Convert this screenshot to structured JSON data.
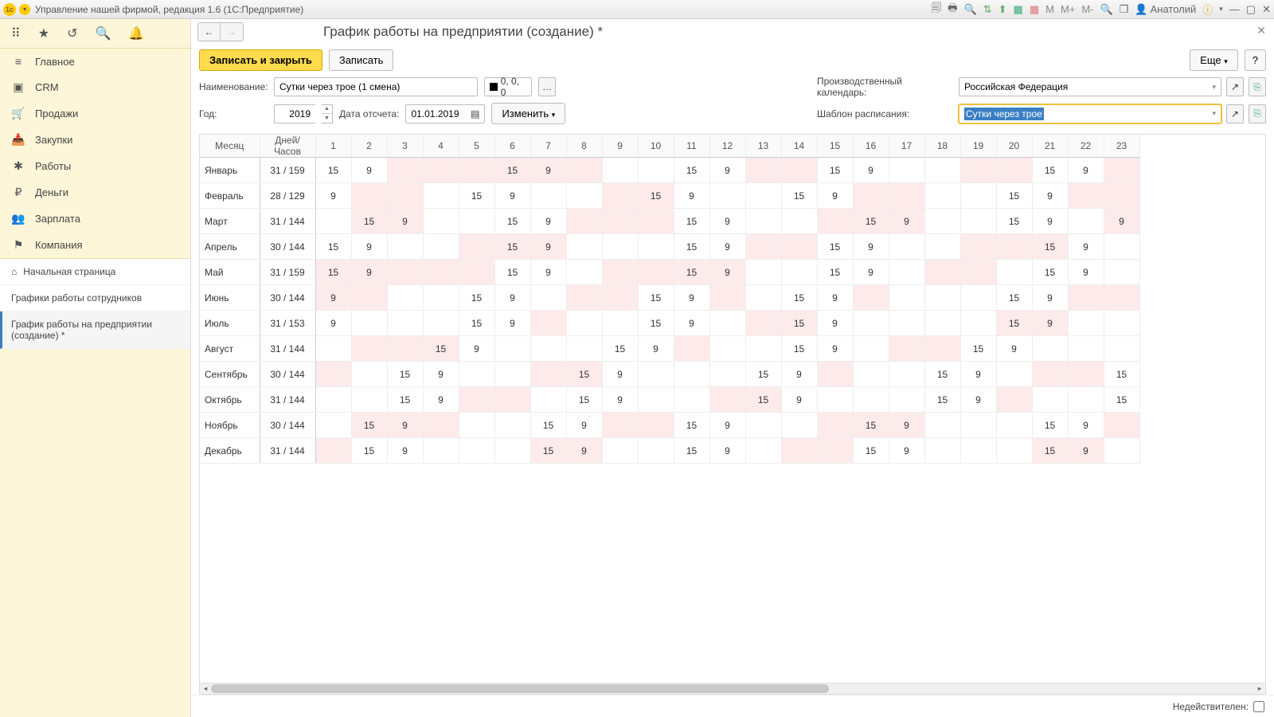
{
  "titlebar": {
    "title": "Управление нашей фирмой, редакция 1.6  (1С:Предприятие)",
    "user": "Анатолий",
    "m_labels": [
      "M",
      "M+",
      "M-"
    ]
  },
  "sidebar": {
    "sections": [
      {
        "icon": "≡",
        "label": "Главное"
      },
      {
        "icon": "▣",
        "label": "CRM"
      },
      {
        "icon": "🛒",
        "label": "Продажи"
      },
      {
        "icon": "📥",
        "label": "Закупки"
      },
      {
        "icon": "✱",
        "label": "Работы"
      },
      {
        "icon": "₽",
        "label": "Деньги"
      },
      {
        "icon": "👥",
        "label": "Зарплата"
      },
      {
        "icon": "⚑",
        "label": "Компания"
      }
    ],
    "lower": [
      {
        "icon": "⌂",
        "label": "Начальная страница"
      },
      {
        "icon": "",
        "label": "Графики работы сотрудников"
      },
      {
        "icon": "",
        "label": "График работы на предприятии (создание) *",
        "active": true
      }
    ]
  },
  "page": {
    "title": "График работы на предприятии (создание) *",
    "btn_save_close": "Записать и закрыть",
    "btn_save": "Записать",
    "btn_more": "Еще",
    "btn_help": "?",
    "lbl_name": "Наименование:",
    "val_name": "Сутки через трое (1 смена)",
    "val_color": "0, 0, 0",
    "lbl_year": "Год:",
    "val_year": "2019",
    "lbl_startdate": "Дата отсчета:",
    "val_startdate": "01.01.2019",
    "btn_change": "Изменить",
    "lbl_calendar": "Производственный календарь:",
    "val_calendar": "Российская Федерация",
    "lbl_template": "Шаблон расписания:",
    "val_template": "Сутки через трое",
    "footer_label": "Недействителен:"
  },
  "grid": {
    "hdr_month": "Месяц",
    "hdr_dh": "Дней/Часов",
    "days": [
      "1",
      "2",
      "3",
      "4",
      "5",
      "6",
      "7",
      "8",
      "9",
      "10",
      "11",
      "12",
      "13",
      "14",
      "15",
      "16",
      "17",
      "18",
      "19",
      "20",
      "21",
      "22",
      "23"
    ],
    "rows": [
      {
        "m": "Январь",
        "dh": "31 / 159",
        "c": [
          {
            "v": "15"
          },
          {
            "v": "9"
          },
          {
            "p": 1
          },
          {
            "p": 1
          },
          {
            "p": 1
          },
          {
            "v": "15",
            "p": 1
          },
          {
            "v": "9",
            "p": 1
          },
          {
            "p": 1
          },
          {},
          {},
          {
            "v": "15"
          },
          {
            "v": "9"
          },
          {
            "p": 1
          },
          {
            "p": 1
          },
          {
            "v": "15"
          },
          {
            "v": "9"
          },
          {},
          {},
          {
            "p": 1
          },
          {
            "p": 1
          },
          {
            "v": "15"
          },
          {
            "v": "9"
          },
          {
            "p": 1
          }
        ]
      },
      {
        "m": "Февраль",
        "dh": "28 / 129",
        "c": [
          {
            "v": "9"
          },
          {
            "p": 1
          },
          {
            "p": 1
          },
          {},
          {
            "v": "15"
          },
          {
            "v": "9"
          },
          {},
          {},
          {
            "p": 1
          },
          {
            "v": "15",
            "p": 1
          },
          {
            "v": "9"
          },
          {},
          {},
          {
            "v": "15"
          },
          {
            "v": "9"
          },
          {
            "p": 1
          },
          {
            "p": 1
          },
          {},
          {},
          {
            "v": "15"
          },
          {
            "v": "9"
          },
          {
            "p": 1
          },
          {
            "p": 1
          }
        ]
      },
      {
        "m": "Март",
        "dh": "31 / 144",
        "c": [
          {},
          {
            "v": "15",
            "p": 1
          },
          {
            "v": "9",
            "p": 1
          },
          {},
          {},
          {
            "v": "15"
          },
          {
            "v": "9"
          },
          {
            "p": 1
          },
          {
            "p": 1
          },
          {
            "p": 1
          },
          {
            "v": "15"
          },
          {
            "v": "9"
          },
          {},
          {},
          {
            "p": 1
          },
          {
            "v": "15",
            "p": 1
          },
          {
            "v": "9",
            "p": 1
          },
          {},
          {},
          {
            "v": "15"
          },
          {
            "v": "9"
          },
          {},
          {
            "v": "9",
            "p": 1
          }
        ]
      },
      {
        "m": "Апрель",
        "dh": "30 / 144",
        "c": [
          {
            "v": "15"
          },
          {
            "v": "9"
          },
          {},
          {},
          {
            "p": 1
          },
          {
            "v": "15",
            "p": 1
          },
          {
            "v": "9",
            "p": 1
          },
          {},
          {},
          {},
          {
            "v": "15"
          },
          {
            "v": "9"
          },
          {
            "p": 1
          },
          {
            "p": 1
          },
          {
            "v": "15"
          },
          {
            "v": "9"
          },
          {},
          {},
          {
            "p": 1
          },
          {
            "p": 1
          },
          {
            "v": "15",
            "p": 1
          },
          {
            "v": "9"
          },
          {}
        ]
      },
      {
        "m": "Май",
        "dh": "31 / 159",
        "c": [
          {
            "v": "15",
            "p": 1
          },
          {
            "v": "9",
            "p": 1
          },
          {
            "p": 1
          },
          {
            "p": 1
          },
          {
            "p": 1
          },
          {
            "v": "15"
          },
          {
            "v": "9"
          },
          {},
          {
            "p": 1
          },
          {
            "p": 1
          },
          {
            "v": "15",
            "p": 1
          },
          {
            "v": "9",
            "p": 1
          },
          {},
          {},
          {
            "v": "15"
          },
          {
            "v": "9"
          },
          {},
          {
            "p": 1
          },
          {
            "p": 1
          },
          {},
          {
            "v": "15"
          },
          {
            "v": "9"
          },
          {}
        ]
      },
      {
        "m": "Июнь",
        "dh": "30 / 144",
        "c": [
          {
            "v": "9",
            "p": 1
          },
          {
            "p": 1
          },
          {},
          {},
          {
            "v": "15"
          },
          {
            "v": "9"
          },
          {},
          {
            "p": 1
          },
          {
            "p": 1
          },
          {
            "v": "15"
          },
          {
            "v": "9"
          },
          {
            "p": 1
          },
          {},
          {
            "v": "15"
          },
          {
            "v": "9"
          },
          {
            "p": 1
          },
          {},
          {},
          {},
          {
            "v": "15"
          },
          {
            "v": "9"
          },
          {
            "p": 1
          },
          {
            "p": 1
          }
        ]
      },
      {
        "m": "Июль",
        "dh": "31 / 153",
        "c": [
          {
            "v": "9"
          },
          {},
          {},
          {},
          {
            "v": "15"
          },
          {
            "v": "9"
          },
          {
            "p": 1
          },
          {},
          {},
          {
            "v": "15"
          },
          {
            "v": "9"
          },
          {},
          {
            "p": 1
          },
          {
            "v": "15",
            "p": 1
          },
          {
            "v": "9"
          },
          {},
          {},
          {},
          {},
          {
            "v": "15",
            "p": 1
          },
          {
            "v": "9",
            "p": 1
          },
          {},
          {}
        ]
      },
      {
        "m": "Август",
        "dh": "31 / 144",
        "c": [
          {},
          {
            "p": 1
          },
          {
            "p": 1
          },
          {
            "v": "15",
            "p": 1
          },
          {
            "v": "9"
          },
          {},
          {},
          {},
          {
            "v": "15"
          },
          {
            "v": "9"
          },
          {
            "p": 1
          },
          {},
          {},
          {
            "v": "15"
          },
          {
            "v": "9"
          },
          {},
          {
            "p": 1
          },
          {
            "p": 1
          },
          {
            "v": "15"
          },
          {
            "v": "9"
          },
          {},
          {},
          {}
        ]
      },
      {
        "m": "Сентябрь",
        "dh": "30 / 144",
        "c": [
          {
            "p": 1
          },
          {},
          {
            "v": "15"
          },
          {
            "v": "9"
          },
          {},
          {},
          {
            "p": 1
          },
          {
            "v": "15",
            "p": 1
          },
          {
            "v": "9"
          },
          {},
          {},
          {},
          {
            "v": "15"
          },
          {
            "v": "9"
          },
          {
            "p": 1
          },
          {},
          {},
          {
            "v": "15"
          },
          {
            "v": "9"
          },
          {},
          {
            "p": 1
          },
          {
            "p": 1
          },
          {
            "v": "15"
          }
        ]
      },
      {
        "m": "Октябрь",
        "dh": "31 / 144",
        "c": [
          {},
          {},
          {
            "v": "15"
          },
          {
            "v": "9"
          },
          {
            "p": 1
          },
          {
            "p": 1
          },
          {},
          {
            "v": "15"
          },
          {
            "v": "9"
          },
          {},
          {},
          {
            "p": 1
          },
          {
            "v": "15",
            "p": 1
          },
          {
            "v": "9"
          },
          {},
          {},
          {},
          {
            "v": "15"
          },
          {
            "v": "9"
          },
          {
            "p": 1
          },
          {},
          {},
          {
            "v": "15"
          }
        ]
      },
      {
        "m": "Ноябрь",
        "dh": "30 / 144",
        "c": [
          {},
          {
            "v": "15",
            "p": 1
          },
          {
            "v": "9",
            "p": 1
          },
          {
            "p": 1
          },
          {},
          {},
          {
            "v": "15"
          },
          {
            "v": "9"
          },
          {
            "p": 1
          },
          {
            "p": 1
          },
          {
            "v": "15"
          },
          {
            "v": "9"
          },
          {},
          {},
          {
            "p": 1
          },
          {
            "v": "15",
            "p": 1
          },
          {
            "v": "9",
            "p": 1
          },
          {},
          {},
          {},
          {
            "v": "15"
          },
          {
            "v": "9"
          },
          {
            "p": 1
          }
        ]
      },
      {
        "m": "Декабрь",
        "dh": "31 / 144",
        "c": [
          {
            "p": 1
          },
          {
            "v": "15"
          },
          {
            "v": "9"
          },
          {},
          {},
          {},
          {
            "v": "15",
            "p": 1
          },
          {
            "v": "9",
            "p": 1
          },
          {},
          {},
          {
            "v": "15"
          },
          {
            "v": "9"
          },
          {},
          {
            "p": 1
          },
          {
            "p": 1
          },
          {
            "v": "15"
          },
          {
            "v": "9"
          },
          {},
          {},
          {},
          {
            "v": "15",
            "p": 1
          },
          {
            "v": "9",
            "p": 1
          },
          {}
        ]
      }
    ]
  }
}
